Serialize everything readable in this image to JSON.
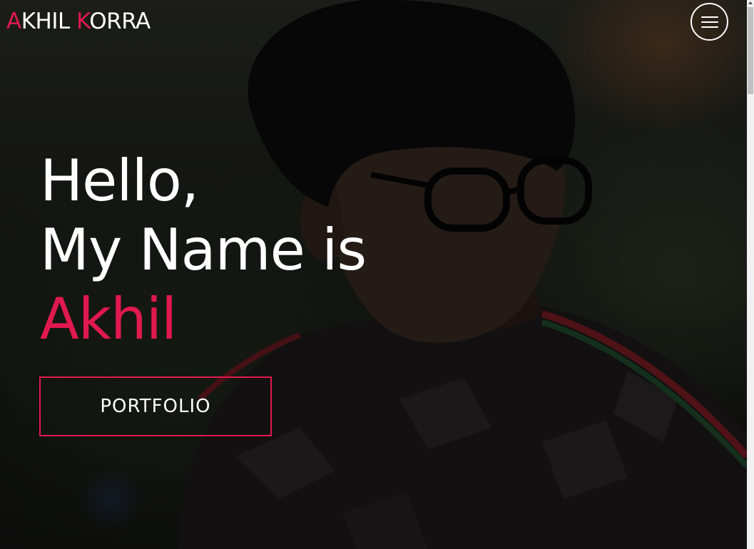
{
  "header": {
    "brand": {
      "first_initial": "A",
      "first_rest": "KHIL ",
      "last_initial": "K",
      "last_rest": "ORRA"
    },
    "menu_icon": "hamburger-menu-icon"
  },
  "hero": {
    "line1": "Hello,",
    "line2": "My Name is",
    "name": "Akhil",
    "button_label": "PORTFOLIO"
  },
  "colors": {
    "accent": "#e0194e",
    "text": "#ffffff"
  }
}
